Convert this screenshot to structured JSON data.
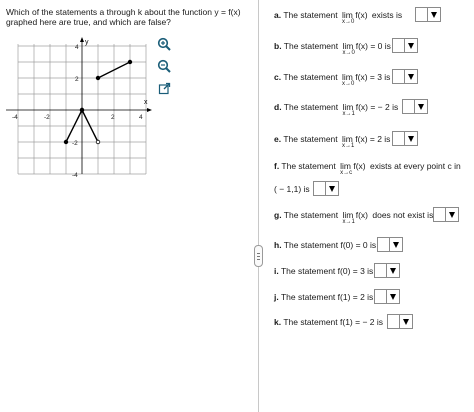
{
  "question": "Which of the statements a through k about the function y = f(x) graphed here are true, and which are false?",
  "graph": {
    "x_label": "x",
    "y_label": "y",
    "ticks": {
      "x_neg4": "-4",
      "x_neg2": "-2",
      "x_2": "2",
      "x_4": "4",
      "y_4": "4",
      "y_2": "2",
      "y_neg2": "-2",
      "y_neg4": "-4"
    },
    "axis_range": {
      "x": [
        -4,
        4
      ],
      "y": [
        -4,
        4
      ]
    },
    "grid": true,
    "pieces": [
      {
        "from": [
          1,
          2
        ],
        "to": [
          3,
          3
        ],
        "from_open": false,
        "to_open": false
      },
      {
        "from": [
          -1,
          -2
        ],
        "to": [
          0,
          0
        ],
        "from_open": false,
        "to_open": false
      },
      {
        "from": [
          0,
          0
        ],
        "to": [
          1,
          -2
        ],
        "from_open": false,
        "to_open": true
      }
    ]
  },
  "tools": [
    "zoom-in-icon",
    "zoom-out-icon",
    "popout-icon"
  ],
  "statements": {
    "a": {
      "label": "a.",
      "pre": "The statement",
      "lim": "lim f(x)",
      "sub": "x→0",
      "post": "exists is"
    },
    "b": {
      "label": "b.",
      "pre": "The statement",
      "lim": "lim f(x) = 0 is",
      "sub": "x→0"
    },
    "c": {
      "label": "c.",
      "pre": "The statement",
      "lim": "lim f(x) = 3 is",
      "sub": "x→0"
    },
    "d": {
      "label": "d.",
      "pre": "The statement",
      "lim": "lim f(x) = − 2 is",
      "sub": "x→1"
    },
    "e": {
      "label": "e.",
      "pre": "The statement",
      "lim": "lim f(x) = 2 is",
      "sub": "x→1"
    },
    "f": {
      "label": "f.",
      "pre": "The statement",
      "lim": "lim f(x)",
      "sub": "x→c",
      "post": "exists at every point c in",
      "line2": "( − 1,1) is"
    },
    "g": {
      "label": "g.",
      "pre": "The statement",
      "lim": "lim f(x)",
      "sub": "x→1",
      "post": "does not exist is"
    },
    "h": {
      "label": "h.",
      "text": "The statement f(0) = 0 is"
    },
    "i": {
      "label": "i.",
      "text": "The statement f(0) = 3 is"
    },
    "j": {
      "label": "j.",
      "text": "The statement f(1) = 2 is"
    },
    "k": {
      "label": "k.",
      "text": "The statement f(1) = − 2 is"
    }
  }
}
